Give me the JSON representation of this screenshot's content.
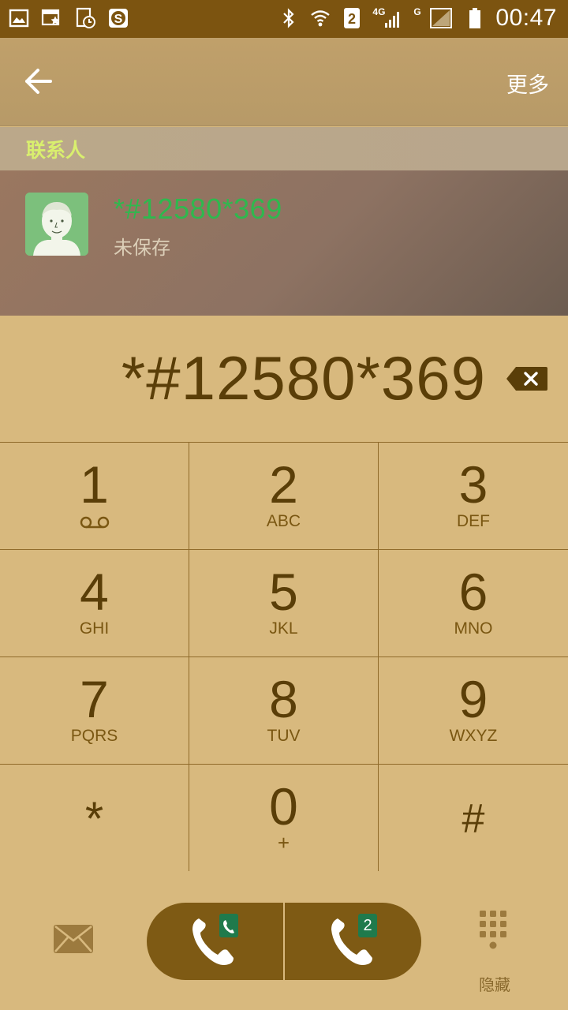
{
  "status_bar": {
    "time": "00:47",
    "sim_slot_badge": "2",
    "network_4g": "4G",
    "network_g": "G",
    "left_icons": [
      "gallery-icon",
      "calendar-icon",
      "clock-file-icon",
      "s-app-icon"
    ],
    "right_icons": [
      "bluetooth-icon",
      "wifi-icon",
      "sim2-icon",
      "signal-4g-icon",
      "signal-g-icon",
      "battery-icon"
    ]
  },
  "app_bar": {
    "back_icon": "arrow-left-icon",
    "more_label": "更多"
  },
  "contacts": {
    "section_title": "联系人",
    "result": {
      "number": "*#12580*369",
      "status": "未保存",
      "avatar_icon": "default-avatar-icon"
    }
  },
  "dialer": {
    "entered_number": "*#12580*369",
    "backspace_icon": "backspace-icon",
    "keys": [
      {
        "digit": "1",
        "letters": ""
      },
      {
        "digit": "2",
        "letters": "ABC"
      },
      {
        "digit": "3",
        "letters": "DEF"
      },
      {
        "digit": "4",
        "letters": "GHI"
      },
      {
        "digit": "5",
        "letters": "JKL"
      },
      {
        "digit": "6",
        "letters": "MNO"
      },
      {
        "digit": "7",
        "letters": "PQRS"
      },
      {
        "digit": "8",
        "letters": "TUV"
      },
      {
        "digit": "9",
        "letters": "WXYZ"
      },
      {
        "digit": "*",
        "letters": ""
      },
      {
        "digit": "0",
        "letters": "+"
      },
      {
        "digit": "#",
        "letters": ""
      }
    ]
  },
  "bottom_bar": {
    "message_icon": "envelope-icon",
    "call_sim1_badge": "",
    "call_sim2_badge": "2",
    "hide_label": "隐藏"
  },
  "colors": {
    "status_bar": "#7c5410",
    "keypad_bg": "#d8b97e",
    "text_dark": "#5a3e08",
    "accent_green": "#2fb84e",
    "section_title": "#d9ef6e",
    "call_button": "#7e5a14"
  }
}
